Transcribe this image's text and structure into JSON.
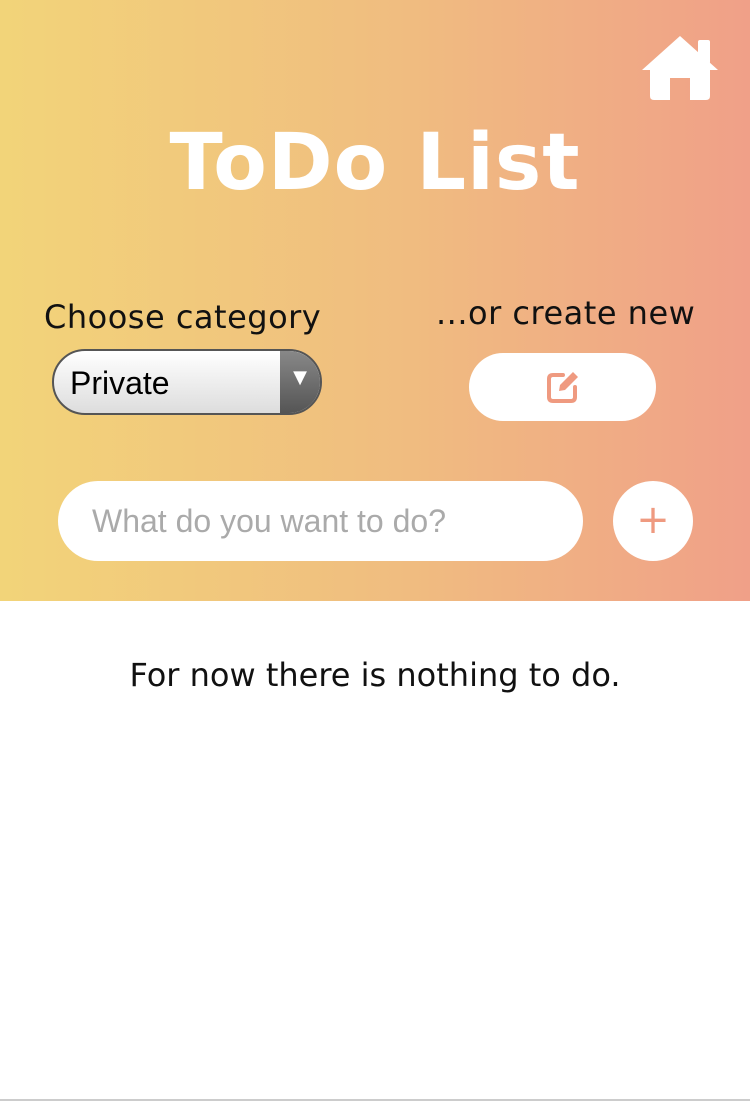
{
  "header": {
    "title": "ToDo List",
    "home_icon": "home-icon"
  },
  "category": {
    "label": "Choose category",
    "selected": "Private"
  },
  "create": {
    "label": "...or create new",
    "icon": "edit-icon"
  },
  "task_input": {
    "placeholder": "What do you want to do?",
    "value": "",
    "add_label": "+"
  },
  "list": {
    "empty_message": "For now there is nothing to do."
  },
  "colors": {
    "gradient_start": "#f2d479",
    "gradient_end": "#f0a088",
    "accent": "#ef9a80"
  }
}
